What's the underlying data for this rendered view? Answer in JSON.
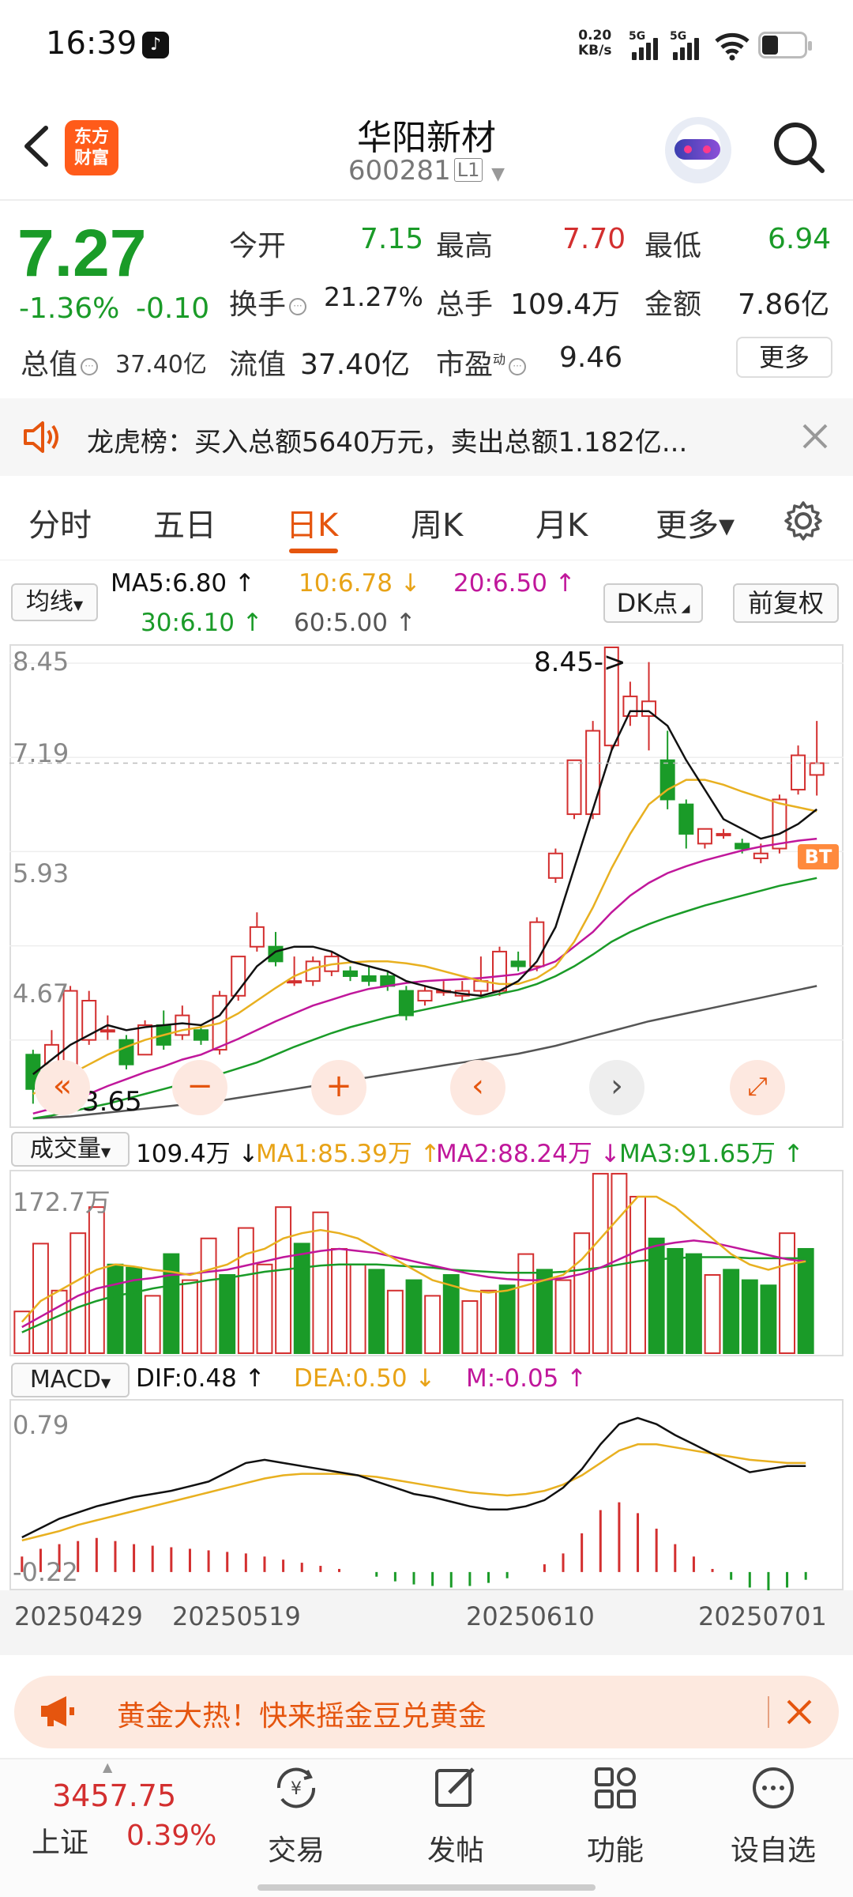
{
  "status_bar": {
    "time": "16:39",
    "net_speed_value": "0.20",
    "net_speed_unit": "KB/s",
    "sim1": "5G",
    "sim2": "5G",
    "battery_level": 0.25
  },
  "header": {
    "app_logo": "东方\n财富",
    "stock_name": "华阳新材",
    "stock_code": "600281",
    "level_badge": "L1"
  },
  "quote": {
    "price": "7.27",
    "change_pct": "-1.36%",
    "change_amt": "-0.10",
    "open_label": "今开",
    "open_value": "7.15",
    "high_label": "最高",
    "high_value": "7.70",
    "low_label": "最低",
    "low_value": "6.94",
    "turnover_label": "换手",
    "turnover_value": "21.27%",
    "volume_label": "总手",
    "volume_value": "109.4万",
    "amount_label": "金额",
    "amount_value": "7.86亿",
    "mktcap_label": "总值",
    "mktcap_value": "37.40亿",
    "float_label": "流值",
    "float_value": "37.40亿",
    "pe_label": "市盈",
    "pe_sup": "动",
    "pe_value": "9.46",
    "more_button": "更多"
  },
  "notice": {
    "text": "龙虎榜：买入总额5640万元，卖出总额1.182亿..."
  },
  "tabs": [
    {
      "label": "分时"
    },
    {
      "label": "五日"
    },
    {
      "label": "日K"
    },
    {
      "label": "周K"
    },
    {
      "label": "月K"
    },
    {
      "label": "更多▾"
    }
  ],
  "ma_row": {
    "type_button": "均线",
    "ma5": "MA5:6.80",
    "ma10": "10:6.78",
    "ma20": "20:6.50",
    "ma30": "30:6.10",
    "ma60": "60:5.00",
    "dk_button": "DK点",
    "adjust_button": "前复权"
  },
  "kchart": {
    "y_labels": [
      "8.45",
      "7.19",
      "5.93",
      "4.67"
    ],
    "max_annotation": "8.45->",
    "min_annotation": "3.65",
    "bt_badge": "BT"
  },
  "volume": {
    "selector": "成交量",
    "value": "109.4万",
    "ma1": "MA1:85.39万",
    "ma2": "MA2:88.24万",
    "ma3": "MA3:91.65万",
    "y_label": "172.7万"
  },
  "macd": {
    "selector": "MACD",
    "dif": "DIF:0.48",
    "dea": "DEA:0.50",
    "m": "M:-0.05",
    "y_top": "0.79",
    "y_bottom": "-0.22"
  },
  "dates": [
    "20250429",
    "20250519",
    "20250610",
    "20250701"
  ],
  "promo": {
    "text": "黄金大热！快来摇金豆兑黄金"
  },
  "bottom_nav": {
    "index_value": "3457.75",
    "index_name": "上证",
    "index_change": "0.39%",
    "items": [
      {
        "label": "交易"
      },
      {
        "label": "发帖"
      },
      {
        "label": "功能"
      },
      {
        "label": "设自选"
      }
    ]
  },
  "colors": {
    "up": "#d32f2f",
    "down": "#1a9b28",
    "accent": "#e5550e",
    "ma5": "#111111",
    "ma10": "#e8b020",
    "ma20": "#c0179b",
    "ma30": "#1a9b28",
    "ma60": "#555555"
  },
  "chart_data": [
    {
      "type": "candlestick",
      "title": "",
      "ylim": [
        3.65,
        8.45
      ],
      "candles": [
        {
          "o": 4.3,
          "c": 3.95,
          "h": 4.35,
          "l": 3.8
        },
        {
          "o": 4.2,
          "c": 4.4,
          "h": 4.55,
          "l": 4.1
        },
        {
          "o": 4.1,
          "c": 4.95,
          "h": 5.0,
          "l": 4.0
        },
        {
          "o": 4.45,
          "c": 4.85,
          "h": 4.95,
          "l": 4.4
        },
        {
          "o": 4.55,
          "c": 4.55,
          "h": 4.7,
          "l": 4.45
        },
        {
          "o": 4.45,
          "c": 4.2,
          "h": 4.5,
          "l": 4.15
        },
        {
          "o": 4.3,
          "c": 4.6,
          "h": 4.65,
          "l": 4.3
        },
        {
          "o": 4.6,
          "c": 4.4,
          "h": 4.75,
          "l": 4.35
        },
        {
          "o": 4.5,
          "c": 4.7,
          "h": 4.8,
          "l": 4.45
        },
        {
          "o": 4.55,
          "c": 4.45,
          "h": 4.6,
          "l": 4.4
        },
        {
          "o": 4.35,
          "c": 4.9,
          "h": 4.95,
          "l": 4.3
        },
        {
          "o": 4.9,
          "c": 5.3,
          "h": 5.3,
          "l": 4.85
        },
        {
          "o": 5.4,
          "c": 5.6,
          "h": 5.75,
          "l": 5.35
        },
        {
          "o": 5.4,
          "c": 5.25,
          "h": 5.55,
          "l": 5.2
        },
        {
          "o": 5.05,
          "c": 5.05,
          "h": 5.3,
          "l": 5.0
        },
        {
          "o": 5.05,
          "c": 5.25,
          "h": 5.3,
          "l": 5.0
        },
        {
          "o": 5.15,
          "c": 5.3,
          "h": 5.35,
          "l": 5.1
        },
        {
          "o": 5.15,
          "c": 5.1,
          "h": 5.2,
          "l": 5.05
        },
        {
          "o": 5.1,
          "c": 5.05,
          "h": 5.2,
          "l": 5.0
        },
        {
          "o": 5.1,
          "c": 5.0,
          "h": 5.15,
          "l": 4.95
        },
        {
          "o": 4.95,
          "c": 4.7,
          "h": 5.0,
          "l": 4.65
        },
        {
          "o": 4.85,
          "c": 4.95,
          "h": 5.0,
          "l": 4.8
        },
        {
          "o": 4.95,
          "c": 4.95,
          "h": 5.05,
          "l": 4.9
        },
        {
          "o": 4.9,
          "c": 4.95,
          "h": 5.05,
          "l": 4.85
        },
        {
          "o": 4.95,
          "c": 5.05,
          "h": 5.3,
          "l": 4.9
        },
        {
          "o": 4.95,
          "c": 5.35,
          "h": 5.4,
          "l": 4.9
        },
        {
          "o": 5.25,
          "c": 5.2,
          "h": 5.35,
          "l": 5.15
        },
        {
          "o": 5.2,
          "c": 5.65,
          "h": 5.7,
          "l": 5.15
        },
        {
          "o": 6.1,
          "c": 6.35,
          "h": 6.4,
          "l": 6.05
        },
        {
          "o": 6.75,
          "c": 7.3,
          "h": 7.3,
          "l": 6.7
        },
        {
          "o": 6.75,
          "c": 7.6,
          "h": 7.7,
          "l": 6.7
        },
        {
          "o": 7.45,
          "c": 8.45,
          "h": 8.45,
          "l": 7.4
        },
        {
          "o": 7.75,
          "c": 7.95,
          "h": 8.1,
          "l": 7.65
        },
        {
          "o": 7.75,
          "c": 7.9,
          "h": 8.3,
          "l": 7.4
        },
        {
          "o": 7.3,
          "c": 6.9,
          "h": 7.6,
          "l": 6.8
        },
        {
          "o": 6.85,
          "c": 6.55,
          "h": 6.9,
          "l": 6.4
        },
        {
          "o": 6.45,
          "c": 6.6,
          "h": 6.6,
          "l": 6.4
        },
        {
          "o": 6.55,
          "c": 6.55,
          "h": 6.6,
          "l": 6.5
        },
        {
          "o": 6.45,
          "c": 6.4,
          "h": 6.5,
          "l": 6.35
        },
        {
          "o": 6.3,
          "c": 6.35,
          "h": 6.45,
          "l": 6.25
        },
        {
          "o": 6.4,
          "c": 6.9,
          "h": 6.95,
          "l": 6.35
        },
        {
          "o": 7.0,
          "c": 7.35,
          "h": 7.45,
          "l": 6.95
        },
        {
          "o": 7.15,
          "c": 7.27,
          "h": 7.7,
          "l": 6.94
        }
      ],
      "ma5": [
        4.1,
        4.25,
        4.4,
        4.5,
        4.6,
        4.55,
        4.58,
        4.6,
        4.62,
        4.6,
        4.7,
        4.95,
        5.2,
        5.35,
        5.4,
        5.4,
        5.35,
        5.25,
        5.2,
        5.15,
        5.05,
        5.0,
        4.95,
        4.92,
        4.9,
        4.95,
        5.05,
        5.25,
        5.6,
        6.2,
        6.8,
        7.4,
        7.8,
        7.8,
        7.65,
        7.3,
        7.0,
        6.7,
        6.6,
        6.5,
        6.55,
        6.65,
        6.8
      ],
      "ma10": [
        3.9,
        4.0,
        4.1,
        4.2,
        4.3,
        4.38,
        4.45,
        4.5,
        4.55,
        4.58,
        4.62,
        4.72,
        4.85,
        4.98,
        5.1,
        5.18,
        5.22,
        5.24,
        5.25,
        5.25,
        5.23,
        5.2,
        5.15,
        5.1,
        5.05,
        5.02,
        5.02,
        5.08,
        5.2,
        5.45,
        5.8,
        6.2,
        6.55,
        6.85,
        7.0,
        7.1,
        7.1,
        7.05,
        6.98,
        6.92,
        6.86,
        6.82,
        6.78
      ],
      "ma20": [
        3.7,
        3.75,
        3.82,
        3.9,
        3.98,
        4.05,
        4.12,
        4.18,
        4.25,
        4.3,
        4.38,
        4.46,
        4.55,
        4.64,
        4.72,
        4.8,
        4.86,
        4.92,
        4.97,
        5.0,
        5.03,
        5.05,
        5.06,
        5.07,
        5.08,
        5.1,
        5.12,
        5.18,
        5.25,
        5.4,
        5.55,
        5.75,
        5.92,
        6.05,
        6.15,
        6.22,
        6.28,
        6.33,
        6.38,
        6.42,
        6.45,
        6.48,
        6.5
      ],
      "ma30": [
        3.65,
        3.68,
        3.72,
        3.76,
        3.8,
        3.85,
        3.9,
        3.95,
        4.0,
        4.05,
        4.1,
        4.16,
        4.22,
        4.3,
        4.38,
        4.45,
        4.52,
        4.58,
        4.63,
        4.68,
        4.72,
        4.76,
        4.8,
        4.84,
        4.88,
        4.92,
        4.96,
        5.02,
        5.1,
        5.2,
        5.32,
        5.45,
        5.55,
        5.63,
        5.7,
        5.76,
        5.82,
        5.87,
        5.92,
        5.97,
        6.02,
        6.06,
        6.1
      ],
      "ma60": [
        3.65,
        3.66,
        3.67,
        3.69,
        3.71,
        3.73,
        3.75,
        3.77,
        3.79,
        3.81,
        3.83,
        3.86,
        3.89,
        3.92,
        3.95,
        3.98,
        4.01,
        4.04,
        4.07,
        4.1,
        4.13,
        4.16,
        4.19,
        4.22,
        4.25,
        4.28,
        4.31,
        4.35,
        4.39,
        4.44,
        4.49,
        4.54,
        4.59,
        4.64,
        4.68,
        4.72,
        4.76,
        4.8,
        4.84,
        4.88,
        4.92,
        4.96,
        5.0
      ]
    },
    {
      "type": "bar",
      "title": "成交量",
      "ylim": [
        0,
        172.7
      ],
      "values": [
        40,
        105,
        60,
        115,
        140,
        85,
        82,
        55,
        95,
        70,
        110,
        75,
        120,
        85,
        140,
        105,
        135,
        100,
        85,
        80,
        60,
        70,
        55,
        75,
        50,
        60,
        65,
        95,
        80,
        70,
        115,
        172,
        172,
        150,
        110,
        100,
        95,
        75,
        80,
        70,
        65,
        115,
        100
      ],
      "up_down": [
        1,
        1,
        1,
        1,
        1,
        -1,
        -1,
        1,
        -1,
        1,
        1,
        -1,
        1,
        1,
        1,
        -1,
        1,
        1,
        1,
        -1,
        1,
        -1,
        1,
        -1,
        1,
        1,
        -1,
        1,
        -1,
        1,
        1,
        1,
        1,
        1,
        -1,
        -1,
        -1,
        1,
        -1,
        -1,
        -1,
        1,
        -1
      ],
      "ma1": [
        30,
        50,
        60,
        70,
        80,
        85,
        83,
        80,
        78,
        75,
        80,
        85,
        95,
        100,
        110,
        115,
        118,
        115,
        110,
        100,
        90,
        80,
        70,
        65,
        60,
        58,
        60,
        65,
        70,
        75,
        90,
        110,
        130,
        150,
        150,
        140,
        125,
        110,
        95,
        85,
        80,
        85,
        88
      ],
      "ma2": [
        25,
        35,
        45,
        55,
        62,
        66,
        70,
        72,
        75,
        76,
        78,
        80,
        84,
        88,
        92,
        95,
        98,
        100,
        98,
        96,
        92,
        88,
        84,
        80,
        76,
        73,
        71,
        70,
        70,
        72,
        76,
        82,
        90,
        98,
        103,
        106,
        108,
        106,
        102,
        98,
        94,
        90,
        88
      ],
      "ma3": [
        20,
        28,
        36,
        44,
        50,
        55,
        58,
        62,
        65,
        67,
        70,
        72,
        75,
        78,
        80,
        82,
        84,
        85,
        85,
        85,
        84,
        83,
        82,
        80,
        79,
        78,
        77,
        77,
        77,
        78,
        80,
        82,
        85,
        88,
        90,
        91,
        92,
        92,
        92,
        91,
        91,
        91,
        91
      ]
    },
    {
      "type": "bar",
      "title": "MACD",
      "ylim": [
        -0.22,
        0.79
      ],
      "hist": [
        0.1,
        0.15,
        0.18,
        0.2,
        0.22,
        0.2,
        0.18,
        0.17,
        0.16,
        0.15,
        0.14,
        0.13,
        0.12,
        0.1,
        0.08,
        0.06,
        0.04,
        0.02,
        0.0,
        -0.03,
        -0.06,
        -0.08,
        -0.09,
        -0.1,
        -0.09,
        -0.07,
        -0.04,
        0.0,
        0.05,
        0.12,
        0.25,
        0.4,
        0.45,
        0.38,
        0.28,
        0.18,
        0.1,
        0.02,
        -0.05,
        -0.1,
        -0.15,
        -0.1,
        -0.05
      ],
      "dif": [
        0.02,
        0.08,
        0.14,
        0.18,
        0.22,
        0.25,
        0.28,
        0.3,
        0.32,
        0.35,
        0.38,
        0.44,
        0.5,
        0.52,
        0.5,
        0.48,
        0.46,
        0.44,
        0.42,
        0.38,
        0.34,
        0.3,
        0.28,
        0.25,
        0.22,
        0.2,
        0.2,
        0.22,
        0.26,
        0.34,
        0.46,
        0.62,
        0.75,
        0.79,
        0.75,
        0.68,
        0.62,
        0.56,
        0.5,
        0.44,
        0.46,
        0.48,
        0.48
      ],
      "dea": [
        0.0,
        0.03,
        0.06,
        0.1,
        0.13,
        0.16,
        0.19,
        0.22,
        0.25,
        0.28,
        0.31,
        0.34,
        0.37,
        0.4,
        0.42,
        0.43,
        0.43,
        0.43,
        0.42,
        0.41,
        0.39,
        0.37,
        0.35,
        0.33,
        0.31,
        0.3,
        0.29,
        0.3,
        0.32,
        0.36,
        0.42,
        0.5,
        0.58,
        0.62,
        0.62,
        0.6,
        0.58,
        0.56,
        0.54,
        0.52,
        0.51,
        0.5,
        0.5
      ]
    }
  ]
}
